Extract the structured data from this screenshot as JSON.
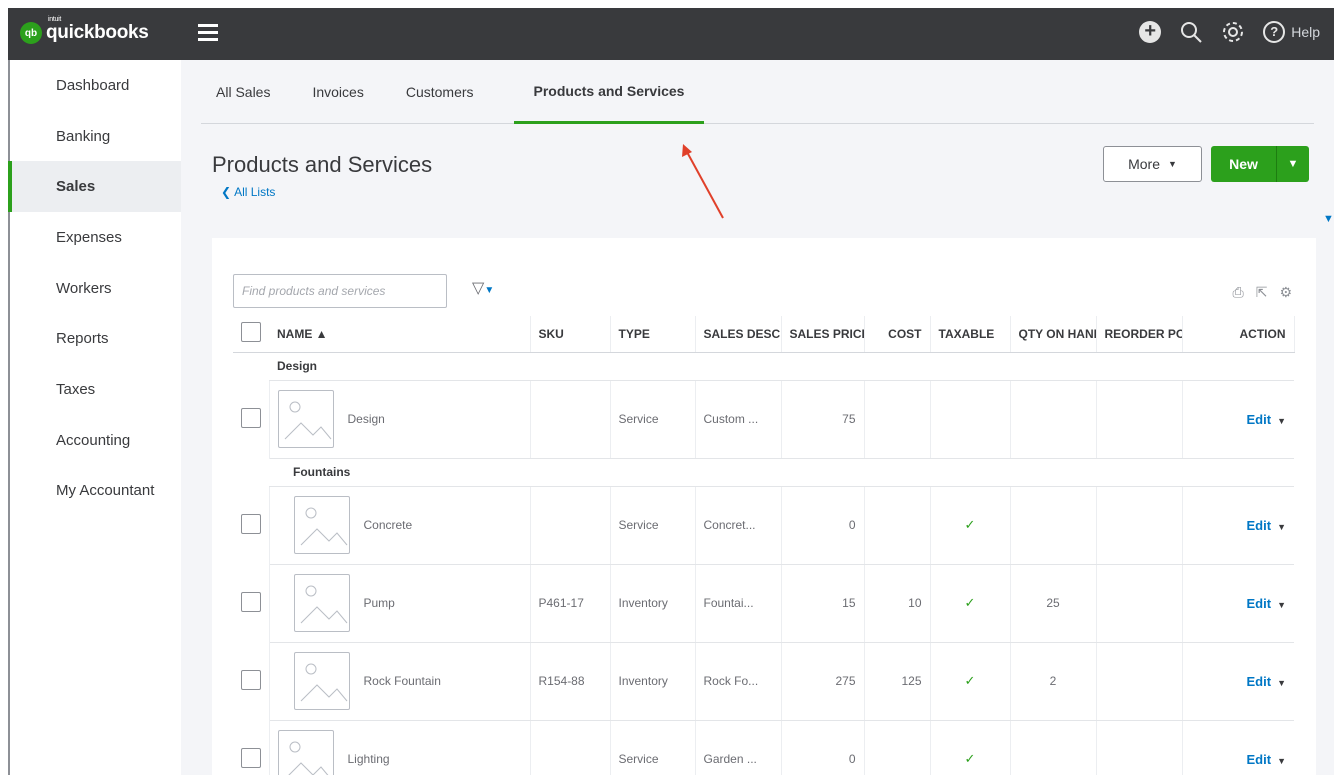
{
  "topbar": {
    "logo_badge": "qb",
    "logo_small": "intuit",
    "logo_text": "quickbooks",
    "help_label": "Help",
    "help_glyph": "?",
    "plus_glyph": "+"
  },
  "sidebar": {
    "items": [
      {
        "label": "Dashboard"
      },
      {
        "label": "Banking"
      },
      {
        "label": "Sales",
        "active": true
      },
      {
        "label": "Expenses"
      },
      {
        "label": "Workers"
      },
      {
        "label": "Reports"
      },
      {
        "label": "Taxes"
      },
      {
        "label": "Accounting"
      },
      {
        "label": "My Accountant"
      }
    ]
  },
  "tabs": [
    {
      "label": "All Sales"
    },
    {
      "label": "Invoices"
    },
    {
      "label": "Customers"
    },
    {
      "label": "Products and Services",
      "active": true
    }
  ],
  "page": {
    "title": "Products and Services",
    "back_link": "All Lists",
    "more_label": "More",
    "new_label": "New"
  },
  "search": {
    "placeholder": "Find products and services"
  },
  "table": {
    "headers": {
      "name": "NAME ▲",
      "sku": "SKU",
      "type": "TYPE",
      "sales_desc": "SALES DESC",
      "sales_price": "SALES PRICE",
      "cost": "COST",
      "taxable": "TAXABLE",
      "qty": "QTY ON HAND",
      "reorder": "REORDER POINT",
      "action": "ACTION"
    },
    "groups": [
      {
        "name": "Design"
      },
      {
        "name": "Fountains"
      }
    ],
    "rows": [
      {
        "name": "Design",
        "sku": "",
        "type": "Service",
        "desc": "Custom ...",
        "price": "75",
        "cost": "",
        "taxable": "",
        "qty": "",
        "reorder": "",
        "action": "Edit"
      },
      {
        "name": "Concrete",
        "sku": "",
        "type": "Service",
        "desc": "Concret...",
        "price": "0",
        "cost": "",
        "taxable": "✓",
        "qty": "",
        "reorder": "",
        "action": "Edit"
      },
      {
        "name": "Pump",
        "sku": "P461-17",
        "type": "Inventory",
        "desc": "Fountai...",
        "price": "15",
        "cost": "10",
        "taxable": "✓",
        "qty": "25",
        "reorder": "",
        "action": "Edit"
      },
      {
        "name": "Rock Fountain",
        "sku": "R154-88",
        "type": "Inventory",
        "desc": "Rock Fo...",
        "price": "275",
        "cost": "125",
        "taxable": "✓",
        "qty": "2",
        "reorder": "",
        "action": "Edit"
      },
      {
        "name": "Lighting",
        "sku": "",
        "type": "Service",
        "desc": "Garden ...",
        "price": "0",
        "cost": "",
        "taxable": "✓",
        "qty": "",
        "reorder": "",
        "action": "Edit"
      }
    ]
  },
  "colors": {
    "brand_green": "#2ca01c",
    "topbar": "#393a3d",
    "link_blue": "#0077c5",
    "annotation_arrow": "#e0402a"
  }
}
